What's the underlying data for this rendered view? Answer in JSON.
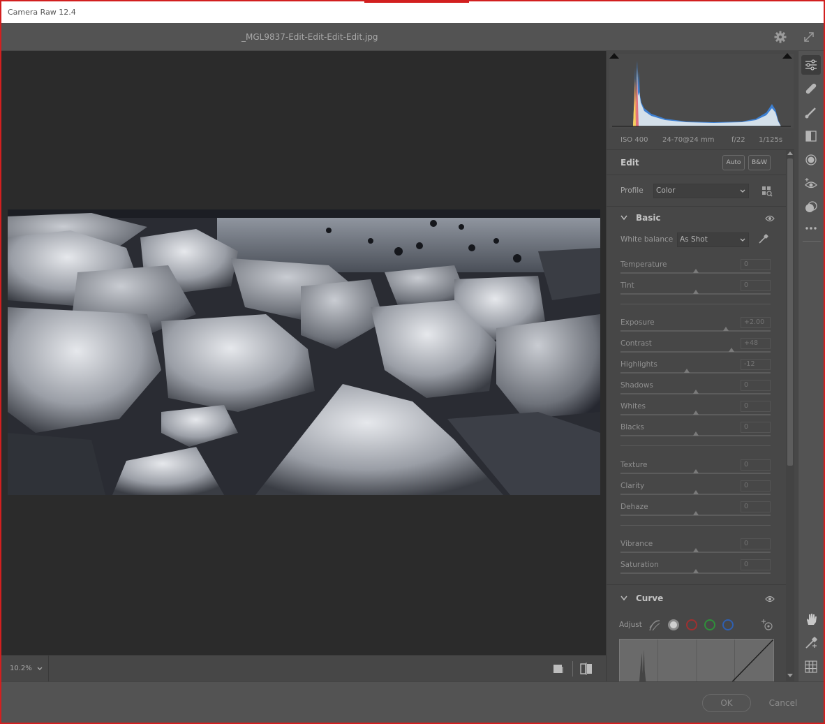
{
  "window": {
    "title": "Camera Raw 12.4"
  },
  "document": {
    "filename": "_MGL9837-Edit-Edit-Edit-Edit.jpg"
  },
  "camera_info": {
    "iso": "ISO 400",
    "lens": "24-70@24 mm",
    "aperture": "f/22",
    "shutter": "1/125s"
  },
  "edit": {
    "title": "Edit",
    "auto_label": "Auto",
    "bw_label": "B&W"
  },
  "profile": {
    "label": "Profile",
    "value": "Color"
  },
  "basic": {
    "title": "Basic",
    "white_balance": {
      "label": "White balance",
      "value": "As Shot"
    },
    "groups": [
      [
        {
          "label": "Temperature",
          "value": "0",
          "pos": 0.5
        },
        {
          "label": "Tint",
          "value": "0",
          "pos": 0.5
        }
      ],
      [
        {
          "label": "Exposure",
          "value": "+2.00",
          "pos": 0.7
        },
        {
          "label": "Contrast",
          "value": "+48",
          "pos": 0.74
        },
        {
          "label": "Highlights",
          "value": "-12",
          "pos": 0.44
        },
        {
          "label": "Shadows",
          "value": "0",
          "pos": 0.5
        },
        {
          "label": "Whites",
          "value": "0",
          "pos": 0.5
        },
        {
          "label": "Blacks",
          "value": "0",
          "pos": 0.5
        }
      ],
      [
        {
          "label": "Texture",
          "value": "0",
          "pos": 0.5
        },
        {
          "label": "Clarity",
          "value": "0",
          "pos": 0.5
        },
        {
          "label": "Dehaze",
          "value": "0",
          "pos": 0.5
        }
      ],
      [
        {
          "label": "Vibrance",
          "value": "0",
          "pos": 0.5
        },
        {
          "label": "Saturation",
          "value": "0",
          "pos": 0.5
        }
      ]
    ]
  },
  "curve": {
    "title": "Curve",
    "adjust_label": "Adjust"
  },
  "zoom": {
    "value": "10.2%"
  },
  "footer": {
    "ok_label": "OK",
    "cancel_label": "Cancel"
  },
  "colors": {
    "accent_red": "#d21f1f",
    "panel_bg": "#474747",
    "canvas_bg": "#2b2b2b"
  }
}
